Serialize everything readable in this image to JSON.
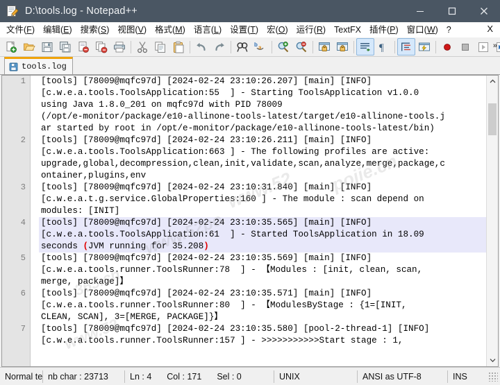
{
  "window": {
    "title": "D:\\tools.log - Notepad++",
    "icon": "notepad-plus-plus-icon",
    "minimize": "–",
    "maximize": "□",
    "close": "✕"
  },
  "menubar": {
    "items": [
      {
        "label": "文件",
        "accel": "F"
      },
      {
        "label": "编辑",
        "accel": "E"
      },
      {
        "label": "搜索",
        "accel": "S"
      },
      {
        "label": "视图",
        "accel": "V"
      },
      {
        "label": "格式",
        "accel": "M"
      },
      {
        "label": "语言",
        "accel": "L"
      },
      {
        "label": "设置",
        "accel": "T"
      },
      {
        "label": "宏",
        "accel": "O"
      },
      {
        "label": "运行",
        "accel": "R"
      },
      {
        "label": "TextFX",
        "accel": ""
      },
      {
        "label": "插件",
        "accel": "P"
      },
      {
        "label": "窗口",
        "accel": "W"
      },
      {
        "label": "?",
        "accel": ""
      }
    ],
    "close_doc": "X"
  },
  "toolbar": {
    "overflow": "»",
    "buttons": [
      {
        "name": "new-file-icon",
        "tip": "新建",
        "active": false
      },
      {
        "name": "open-file-icon",
        "tip": "打开",
        "active": false
      },
      {
        "name": "save-icon",
        "tip": "保存",
        "active": false
      },
      {
        "name": "save-all-icon",
        "tip": "保存所有",
        "active": false
      },
      {
        "name": "close-file-icon",
        "tip": "关闭",
        "active": false
      },
      {
        "name": "close-all-icon",
        "tip": "关闭所有",
        "active": false
      },
      {
        "name": "print-icon",
        "tip": "打印",
        "active": false
      },
      {
        "name": "separator",
        "tip": "",
        "active": false
      },
      {
        "name": "cut-icon",
        "tip": "剪切",
        "active": false
      },
      {
        "name": "copy-icon",
        "tip": "复制",
        "active": false
      },
      {
        "name": "paste-icon",
        "tip": "粘贴",
        "active": false
      },
      {
        "name": "separator",
        "tip": "",
        "active": false
      },
      {
        "name": "undo-icon",
        "tip": "撤销",
        "active": false
      },
      {
        "name": "redo-icon",
        "tip": "重做",
        "active": false
      },
      {
        "name": "separator",
        "tip": "",
        "active": false
      },
      {
        "name": "find-icon",
        "tip": "查找",
        "active": false
      },
      {
        "name": "replace-icon",
        "tip": "替换",
        "active": false
      },
      {
        "name": "separator",
        "tip": "",
        "active": false
      },
      {
        "name": "zoom-in-icon",
        "tip": "放大",
        "active": false
      },
      {
        "name": "zoom-out-icon",
        "tip": "缩小",
        "active": false
      },
      {
        "name": "separator",
        "tip": "",
        "active": false
      },
      {
        "name": "sync-vertical-icon",
        "tip": "垂直同步滚动",
        "active": false
      },
      {
        "name": "sync-horizontal-icon",
        "tip": "水平同步滚动",
        "active": false
      },
      {
        "name": "separator",
        "tip": "",
        "active": false
      },
      {
        "name": "word-wrap-icon",
        "tip": "自动换行",
        "active": true
      },
      {
        "name": "show-all-chars-icon",
        "tip": "显示所有字符",
        "active": false
      },
      {
        "name": "separator",
        "tip": "",
        "active": false
      },
      {
        "name": "indent-guide-icon",
        "tip": "缩进参考线",
        "active": true
      },
      {
        "name": "user-define-dialog-icon",
        "tip": "用户自定义语言",
        "active": false
      },
      {
        "name": "separator",
        "tip": "",
        "active": false
      },
      {
        "name": "record-macro-icon",
        "tip": "开始录制宏",
        "active": false
      },
      {
        "name": "stop-macro-icon",
        "tip": "停止录制宏",
        "active": false
      },
      {
        "name": "play-macro-icon",
        "tip": "播放宏",
        "active": false
      },
      {
        "name": "run-macro-multiple-icon",
        "tip": "多次运行宏",
        "active": false
      },
      {
        "name": "save-macro-icon",
        "tip": "保存当前录制的宏",
        "active": false
      }
    ]
  },
  "tabs": [
    {
      "label": "tools.log",
      "icon": "saved-disk-icon",
      "active": true
    }
  ],
  "editor": {
    "line_numbers": [
      "1",
      "2",
      "3",
      "4",
      "5",
      "6",
      "7"
    ],
    "highlighted_line": 4,
    "watermark": "www.52pojie.cn  365.cn",
    "lines": [
      {
        "number": "1",
        "highlighted": false,
        "rows": [
          "[tools] [78009@mqfc97d] [2024-02-24 23:10:26.207] [main] [INFO]",
          "[c.w.e.a.tools.ToolsApplication:55  ] - Starting ToolsApplication v1.0.0",
          "using Java 1.8.0_201 on mqfc97d with PID 78009",
          "(/opt/e-monitor/package/e10-allinone-tools-latest/target/e10-allinone-tools.j",
          "ar started by root in /opt/e-monitor/package/e10-allinone-tools-latest/bin)"
        ]
      },
      {
        "number": "2",
        "highlighted": false,
        "rows": [
          "[tools] [78009@mqfc97d] [2024-02-24 23:10:26.211] [main] [INFO]",
          "[c.w.e.a.tools.ToolsApplication:663 ] - The following profiles are active:",
          "upgrade,global,decompression,clean,init,validate,scan,analyze,merge,package,c",
          "ontainer,plugins,env"
        ]
      },
      {
        "number": "3",
        "highlighted": false,
        "rows": [
          "[tools] [78009@mqfc97d] [2024-02-24 23:10:31.840] [main] [INFO]",
          "[c.w.e.a.t.g.service.GlobalProperties:160 ] - The module : scan depend on",
          "modules: [INIT]"
        ]
      },
      {
        "number": "4",
        "highlighted": true,
        "rows": [
          "[tools] [78009@mqfc97d] [2024-02-24 23:10:35.565] [main] [INFO]",
          "[c.w.e.a.tools.ToolsApplication:61  ] - Started ToolsApplication in 18.09",
          "seconds (JVM running for 35.208)"
        ],
        "brace_row": 2,
        "brace_open": "(",
        "brace_close": ")"
      },
      {
        "number": "5",
        "highlighted": false,
        "rows": [
          "[tools] [78009@mqfc97d] [2024-02-24 23:10:35.569] [main] [INFO]",
          "[c.w.e.a.tools.runner.ToolsRunner:78  ] - 【Modules : [init, clean, scan,",
          "merge, package]】"
        ]
      },
      {
        "number": "6",
        "highlighted": false,
        "rows": [
          "[tools] [78009@mqfc97d] [2024-02-24 23:10:35.571] [main] [INFO]",
          "[c.w.e.a.tools.runner.ToolsRunner:80  ] - 【ModulesByStage : {1=[INIT,",
          "CLEAN, SCAN], 3=[MERGE, PACKAGE]}】"
        ]
      },
      {
        "number": "7",
        "highlighted": false,
        "rows": [
          "[tools] [78009@mqfc97d] [2024-02-24 23:10:35.580] [pool-2-thread-1] [INFO]",
          "[c.w.e.a.tools.runner.ToolsRunner:157 ] - >>>>>>>>>>>Start stage : 1,"
        ]
      }
    ],
    "scroll": {
      "up_arrow": "⌃",
      "down_arrow": "⌄"
    }
  },
  "statusbar": {
    "language": "Normal te",
    "nb_char": "nb char : 23713",
    "ln": "Ln : 4",
    "col": "Col : 171",
    "sel": "Sel : 0",
    "eol": "UNIX",
    "encoding": "ANSI as UTF-8",
    "insert_mode": "INS"
  },
  "colors": {
    "titlebar_bg": "#4a5663",
    "tab_accent": "#f0a30a",
    "highlight_line": "#e8e8fa",
    "brace_match": "#e00000",
    "toolbar_active": "#d5e8fb"
  }
}
